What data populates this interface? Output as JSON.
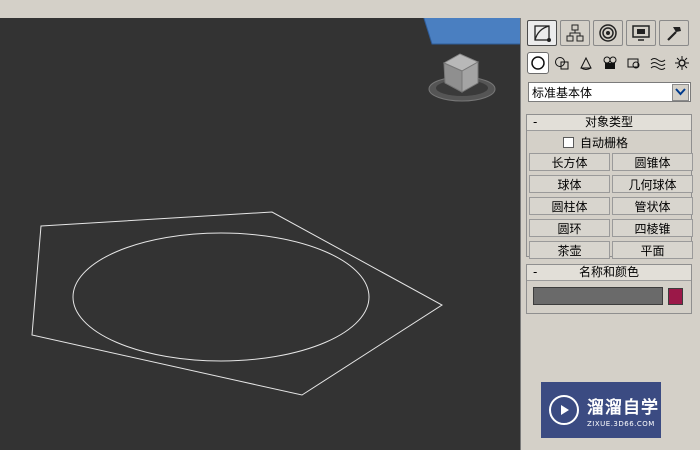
{
  "panel": {
    "tabs": [
      {
        "icon": "create-tab-icon",
        "active": true
      },
      {
        "icon": "hierarchy-tab-icon",
        "active": false
      },
      {
        "icon": "motion-tab-icon",
        "active": false
      },
      {
        "icon": "display-tab-icon",
        "active": false
      },
      {
        "icon": "utilities-tab-icon",
        "active": false
      }
    ],
    "categories": [
      {
        "icon": "geometry-icon",
        "active": true
      },
      {
        "icon": "shapes-icon",
        "active": false
      },
      {
        "icon": "lights-icon",
        "active": false
      },
      {
        "icon": "cameras-icon",
        "active": false
      },
      {
        "icon": "helpers-icon",
        "active": false
      },
      {
        "icon": "space-warps-icon",
        "active": false
      },
      {
        "icon": "systems-icon",
        "active": false
      }
    ],
    "dropdown": {
      "selected": "标准基本体"
    },
    "object_type": {
      "collapse": "-",
      "title": "对象类型",
      "autogrid_label": "自动栅格",
      "buttons": [
        "长方体",
        "圆锥体",
        "球体",
        "几何球体",
        "圆柱体",
        "管状体",
        "圆环",
        "四棱锥",
        "茶壶",
        "平面"
      ]
    },
    "name_color": {
      "collapse": "-",
      "title": "名称和颜色",
      "name_value": "",
      "color": "#9b1848"
    }
  },
  "viewport": {
    "viewcube_icon": "viewcube-icon",
    "annotation_icon": "blue-arrow-icon",
    "accent": "#4a7fc1"
  },
  "watermark": {
    "main": "溜溜自学",
    "sub": "ZIXUE.3D66.COM"
  }
}
